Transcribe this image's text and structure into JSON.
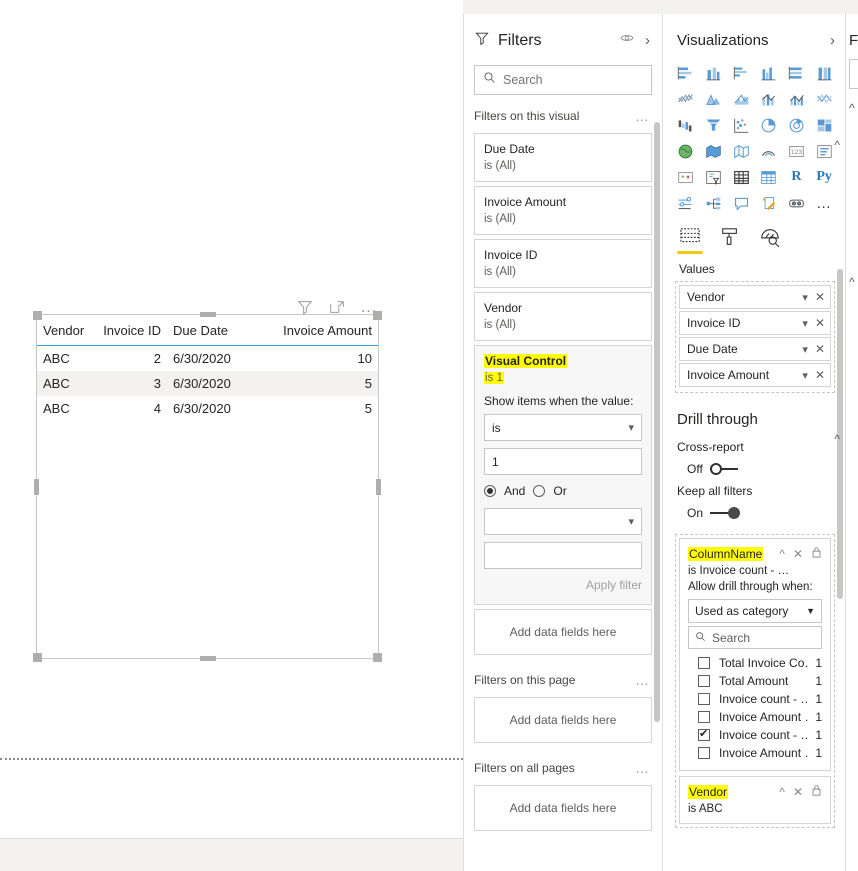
{
  "canvas": {
    "visual_header_icons": [
      "filter-icon",
      "focus-mode-icon",
      "more-options-icon"
    ],
    "table": {
      "columns": [
        "Vendor",
        "Invoice ID",
        "Due Date",
        "Invoice Amount"
      ],
      "rows": [
        [
          "ABC",
          "2",
          "6/30/2020",
          "10"
        ],
        [
          "ABC",
          "3",
          "6/30/2020",
          "5"
        ],
        [
          "ABC",
          "4",
          "6/30/2020",
          "5"
        ]
      ]
    }
  },
  "filters": {
    "title": "Filters",
    "eye_icon": "eye-icon",
    "collapse_icon": "chevron-right-icon",
    "search": {
      "placeholder": "Search",
      "value": ""
    },
    "visual_section": {
      "label": "Filters on this visual",
      "more": "…"
    },
    "visual_filters": [
      {
        "name": "Due Date",
        "state": "is (All)"
      },
      {
        "name": "Invoice Amount",
        "state": "is (All)"
      },
      {
        "name": "Invoice ID",
        "state": "is (All)"
      },
      {
        "name": "Vendor",
        "state": "is (All)"
      }
    ],
    "expanded_filter": {
      "name": "Visual Control",
      "state": "is 1",
      "highlighted": true,
      "show_items_label": "Show items when the value:",
      "condition1": "is",
      "value1": "1",
      "and_label": "And",
      "or_label": "Or",
      "and_selected": true,
      "condition2": "",
      "value2": "",
      "apply_label": "Apply filter"
    },
    "visual_dropzone": "Add data fields here",
    "page_section": {
      "label": "Filters on this page",
      "more": "…"
    },
    "page_dropzone": "Add data fields here",
    "all_pages_section": {
      "label": "Filters on all pages",
      "more": "…"
    },
    "all_pages_dropzone": "Add data fields here"
  },
  "visualizations": {
    "title": "Visualizations",
    "collapse_icon": "chevron-right-icon",
    "gallery_icons": [
      "stacked-bar-chart",
      "stacked-column-chart",
      "clustered-bar-chart",
      "clustered-column-chart",
      "100-stacked-bar-chart",
      "100-stacked-column-chart",
      "line-chart",
      "area-chart",
      "stacked-area-chart",
      "line-stacked-column-chart",
      "line-clustered-column-chart",
      "ribbon-chart",
      "waterfall-chart",
      "funnel-chart",
      "scatter-chart",
      "pie-chart",
      "donut-chart",
      "treemap-chart",
      "map-visual",
      "filled-map-visual",
      "shape-map-visual",
      "arcgis-map-visual",
      "card-visual",
      "multi-row-card-visual",
      "kpi-visual",
      "slicer-visual",
      "table-visual",
      "matrix-visual",
      "r-script-visual",
      "python-visual",
      "key-influencers-visual",
      "decomposition-tree-visual",
      "qna-visual",
      "paginated-report-visual",
      "power-apps-visual",
      "more-visuals-icon"
    ],
    "tabs": [
      {
        "name": "fields-tab",
        "icon": "fields-icon",
        "active": true
      },
      {
        "name": "format-tab",
        "icon": "paint-roller-icon",
        "active": false
      },
      {
        "name": "analytics-tab",
        "icon": "magnifier-icon",
        "active": false
      }
    ],
    "values_label": "Values",
    "value_fields": [
      "Vendor",
      "Invoice ID",
      "Due Date",
      "Invoice Amount"
    ],
    "drill_through": {
      "title": "Drill through",
      "cross_report_label": "Cross-report",
      "cross_report_state": "Off",
      "keep_all_filters_label": "Keep all filters",
      "keep_all_filters_state": "On",
      "cards": [
        {
          "name": "ColumnName",
          "highlighted": true,
          "sub": "is Invoice count - …",
          "allow_label": "Allow drill through when:",
          "dropdown": "Used as category",
          "search_placeholder": "Search",
          "items": [
            {
              "label": "Total Invoice Co…",
              "count": "1",
              "checked": false
            },
            {
              "label": "Total Amount",
              "count": "1",
              "checked": false
            },
            {
              "label": "Invoice count - …",
              "count": "1",
              "checked": false
            },
            {
              "label": "Invoice Amount …",
              "count": "1",
              "checked": false
            },
            {
              "label": "Invoice count - …",
              "count": "1",
              "checked": true
            },
            {
              "label": "Invoice Amount …",
              "count": "1",
              "checked": false
            }
          ]
        },
        {
          "name": "Vendor",
          "highlighted": true,
          "sub": "is ABC"
        }
      ],
      "card_icons": [
        "collapse-caret-icon",
        "remove-icon",
        "lock-icon"
      ]
    }
  },
  "right_panel_sliver": {
    "title": "F"
  }
}
